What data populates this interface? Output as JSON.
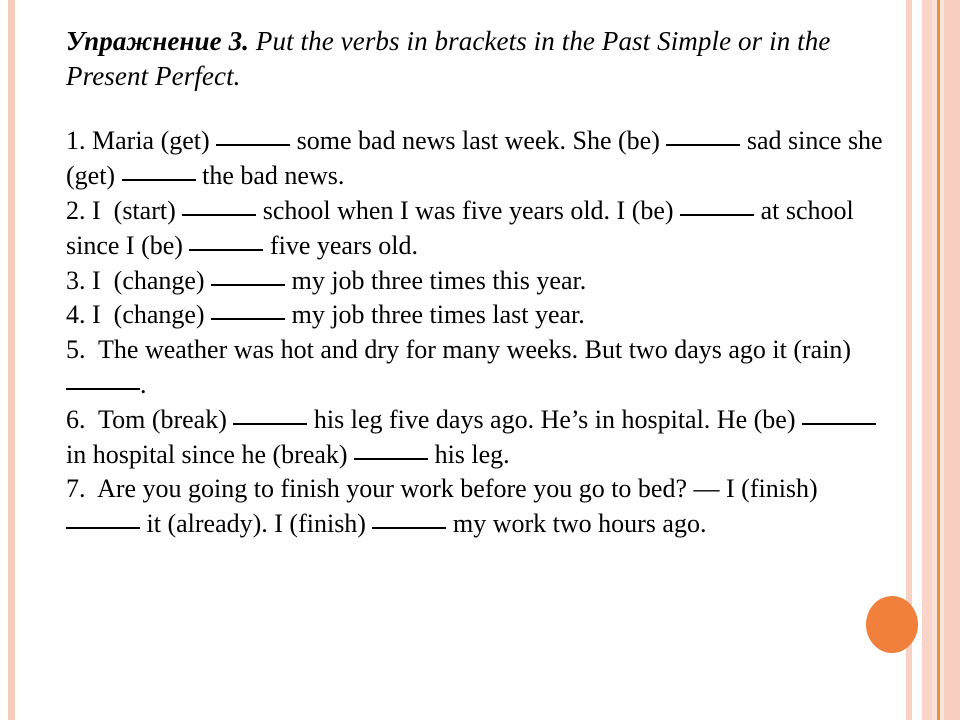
{
  "slide": {
    "title_label": "Упражнение 3.",
    "title_text": " Put the verbs in brackets in the Past Simple or in the Present Perfect.",
    "colors": {
      "accent_circle": "#f0803c",
      "stripe_pink": "#f8cfc0",
      "stripe_orange_line": "#e8913f",
      "text": "#000000",
      "background": "#ffffff"
    },
    "exercises": [
      {
        "number": "1.",
        "segments": [
          " Maria (get) ",
          " some bad news last week. She (be) ",
          " sad since she (get) ",
          " the bad news."
        ]
      },
      {
        "number": "2.",
        "segments": [
          " I  (start) ",
          " school when I was five years old. I (be) ",
          " at school since I (be) ",
          " five years old."
        ]
      },
      {
        "number": "3.",
        "segments": [
          " I  (change) ",
          " my job three times this year."
        ]
      },
      {
        "number": "4.",
        "segments": [
          " I  (change) ",
          " my job three times last year."
        ]
      },
      {
        "number": "5.",
        "segments": [
          "  The weather was hot and dry for many weeks. But two days ago it (rain) ",
          "."
        ]
      },
      {
        "number": "6.",
        "segments": [
          "  Tom (break) ",
          " his leg five days ago. He’s in hospital. He (be) ",
          " in hospital since he (break) ",
          " his leg."
        ]
      },
      {
        "number": "7.",
        "segments": [
          "  Are you going to finish your work before you go to bed? — I (finish) ",
          " it (already). I (finish) ",
          " my work two hours ago."
        ]
      }
    ]
  }
}
